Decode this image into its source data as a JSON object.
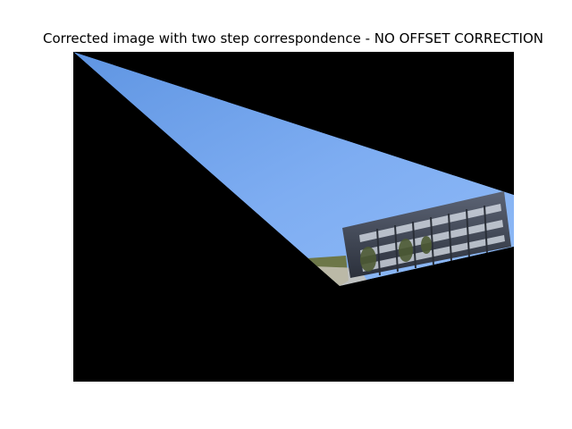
{
  "figure": {
    "title": "Corrected image with two step correspondence - NO OFFSET CORRECTION"
  },
  "image": {
    "background_color": "#000000",
    "sky_color": "#7aa9ee",
    "building_color": "#3b4150",
    "vegetation_color": "#6f7a4a"
  }
}
